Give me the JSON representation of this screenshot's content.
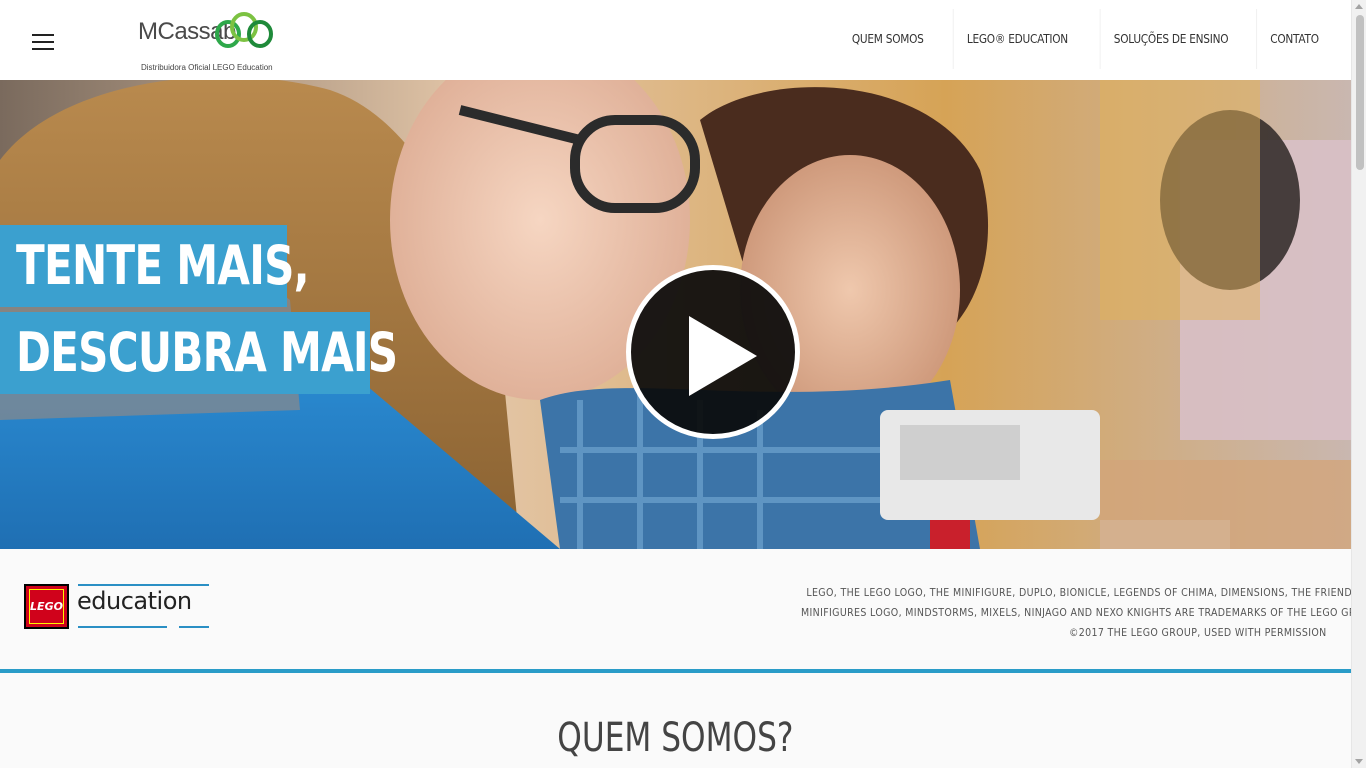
{
  "header": {
    "menu_icon": "hamburger-menu-icon",
    "logo": {
      "name": "MCassab",
      "tagline": "Distribuidora Oficial LEGO Education",
      "colors": [
        "#2ea84a",
        "#7cc242",
        "#1f8a3a"
      ]
    },
    "nav": [
      {
        "label": "QUEM SOMOS"
      },
      {
        "label": "LEGO® EDUCATION"
      },
      {
        "label": "SOLUÇÕES DE ENSINO"
      },
      {
        "label": "CONTATO"
      }
    ]
  },
  "hero": {
    "headline_line1": "TENTE MAIS,",
    "headline_line2": "DESCUBRA MAIS",
    "play_icon": "play-icon",
    "accent_color": "#3ba0cf"
  },
  "footer_strip": {
    "lego_badge": "LEGO",
    "lego_word": "education",
    "trademark_lines": [
      "LEGO, THE LEGO LOGO, THE MINIFIGURE, DUPLO, BIONICLE, LEGENDS OF CHIMA, DIMENSIONS, THE FRIENDS LOGO, THE",
      "MINIFIGURES LOGO, MINDSTORMS, MIXELS, NINJAGO AND NEXO KNIGHTS ARE TRADEMARKS OF THE LEGO GROUP.",
      "©2017 THE LEGO GROUP, USED WITH PERMISSION"
    ],
    "divider_color": "#2a9cc8"
  },
  "section": {
    "title": "QUEM SOMOS?"
  }
}
